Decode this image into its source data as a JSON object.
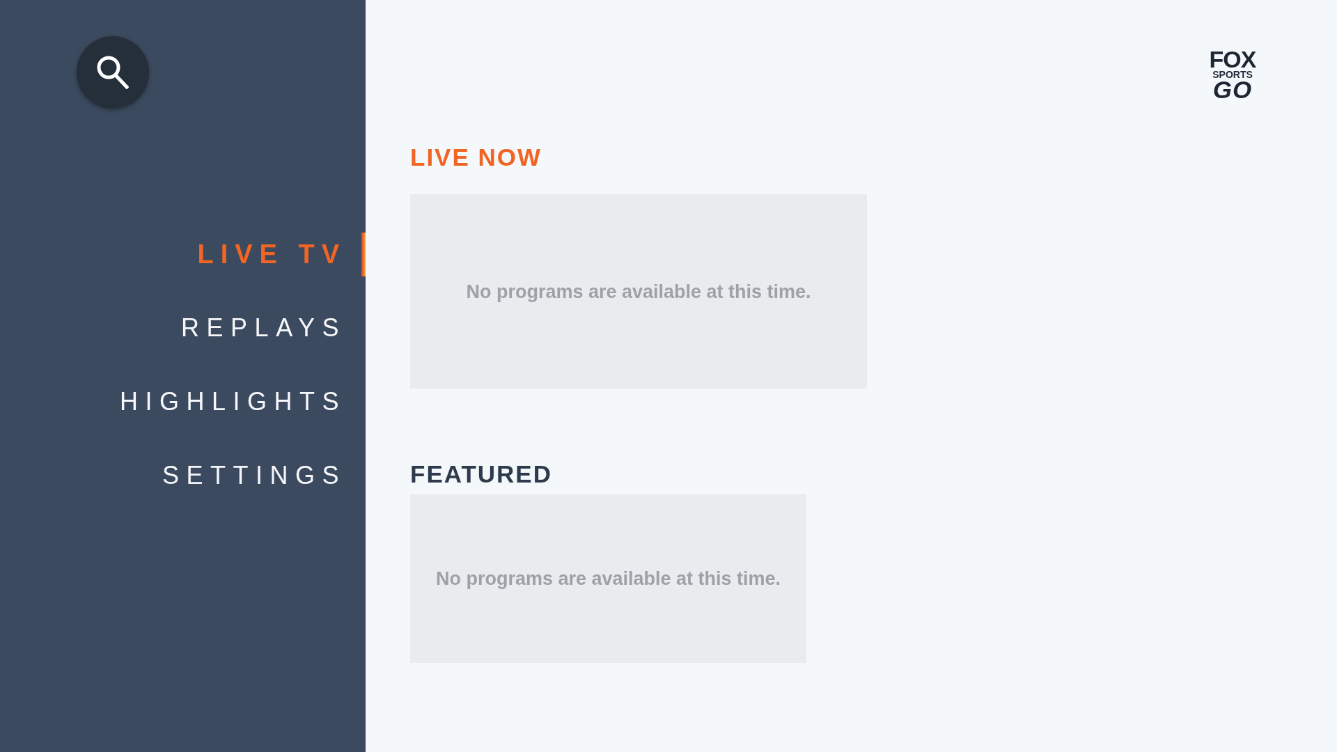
{
  "sidebar": {
    "items": [
      {
        "label": "LIVE TV",
        "selected": true
      },
      {
        "label": "REPLAYS",
        "selected": false
      },
      {
        "label": "HIGHLIGHTS",
        "selected": false
      },
      {
        "label": "SETTINGS",
        "selected": false
      }
    ]
  },
  "logo": {
    "lines": [
      "FOX",
      "SPORTS",
      "GO"
    ]
  },
  "sections": [
    {
      "title": "LIVE NOW",
      "focused": true,
      "message": "No programs are available at this time."
    },
    {
      "title": "FEATURED",
      "focused": false,
      "message": "No programs are available at this time."
    }
  ]
}
